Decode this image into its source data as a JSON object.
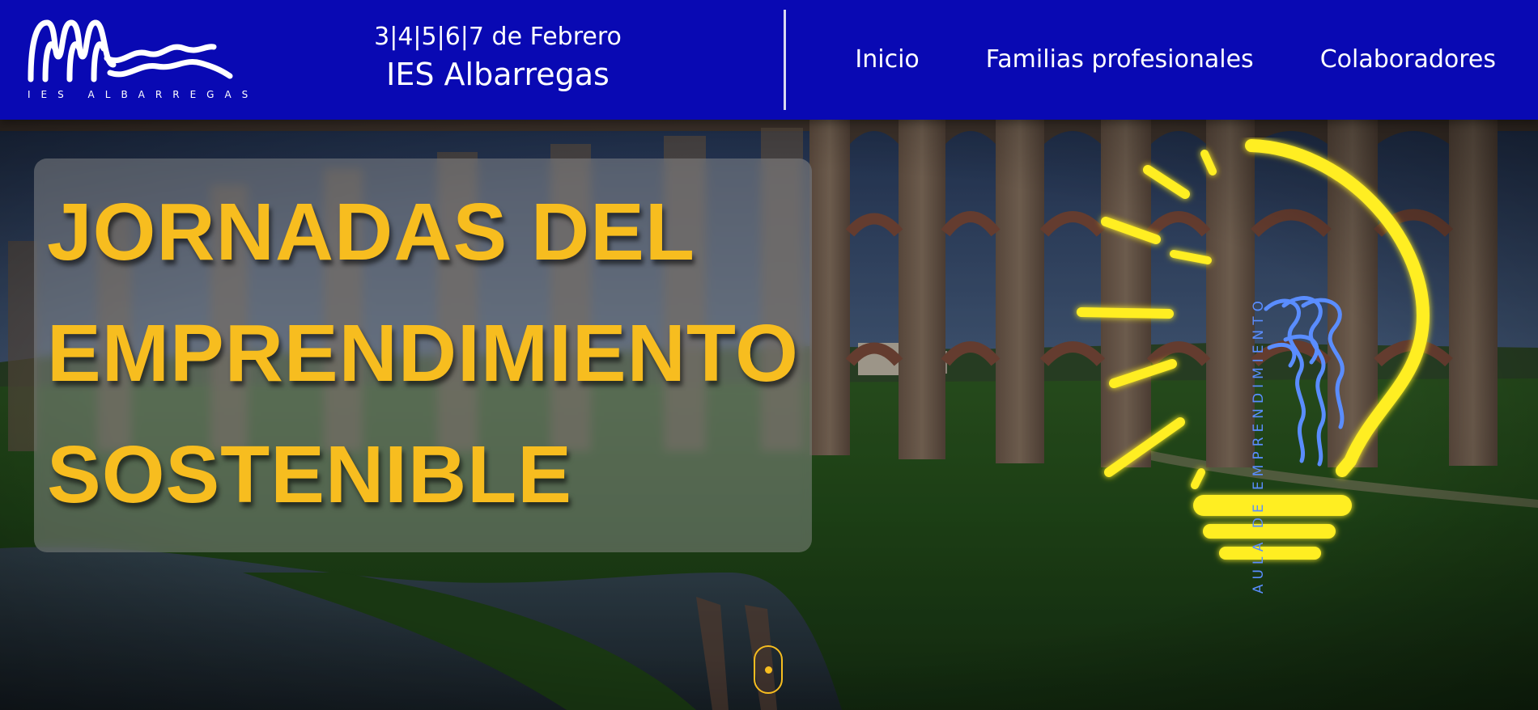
{
  "header": {
    "logo_text": "IES ALBARREGAS",
    "event_dates": "3|4|5|6|7 de Febrero",
    "event_school": "IES Albarregas",
    "nav": [
      {
        "label": "Inicio"
      },
      {
        "label": "Familias profesionales"
      },
      {
        "label": "Colaboradores"
      }
    ]
  },
  "hero": {
    "title_lines": [
      "JORNADAS DEL",
      "EMPRENDIMIENTO",
      "SOSTENIBLE"
    ],
    "bulb_label": "AULA DE EMPRENDIMIENTO"
  },
  "colors": {
    "header_bg": "#0909b3",
    "title_yellow": "#f7bd1f",
    "bulb_yellow": "#ffee22",
    "bulb_blue": "#5a8dff"
  }
}
